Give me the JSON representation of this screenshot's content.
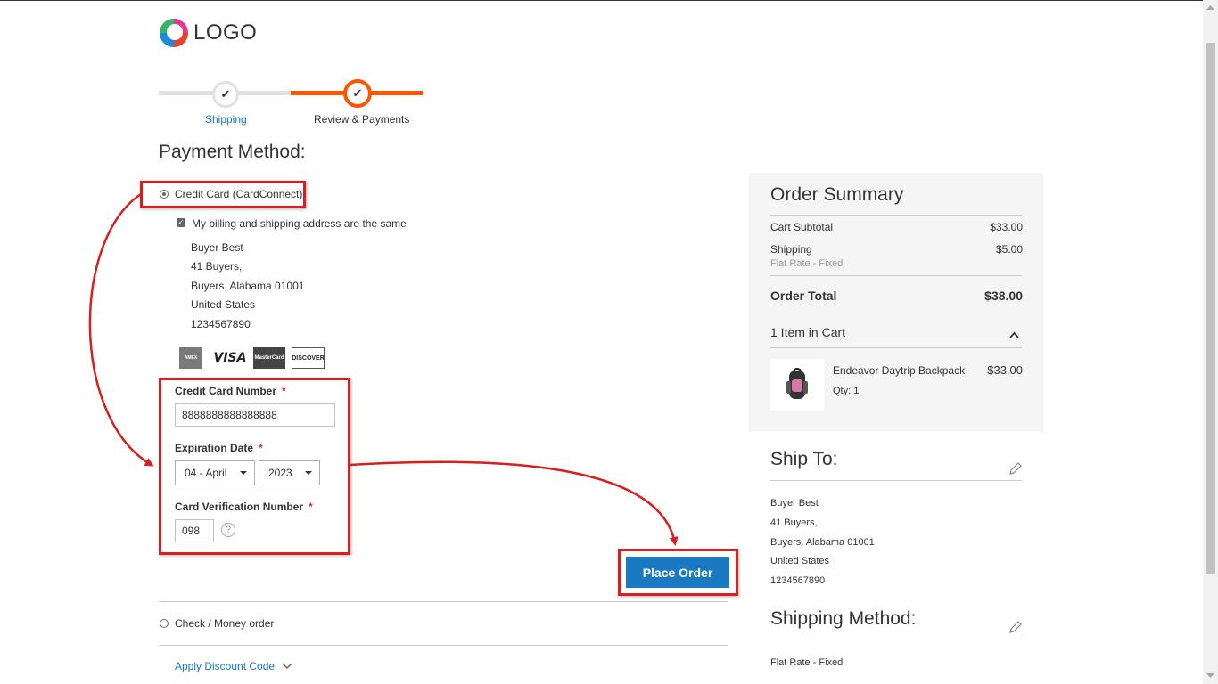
{
  "logo": {
    "text": "LOGO"
  },
  "progress": {
    "steps": [
      {
        "label": "Shipping",
        "status": "done"
      },
      {
        "label": "Review & Payments",
        "status": "active"
      }
    ]
  },
  "payment": {
    "title": "Payment Method:",
    "credit_card_option": "Credit Card (CardConnect)",
    "billing_same_label": "My billing and shipping address are the same",
    "billing_address": [
      "Buyer Best",
      "41 Buyers,",
      "Buyers, Alabama 01001",
      "United States",
      "1234567890"
    ],
    "card_types": [
      "AMEX",
      "VISA",
      "MasterCard",
      "DISCOVER"
    ],
    "card_number_label": "Credit Card Number",
    "card_number_value": "8888888888888888",
    "expiration_label": "Expiration Date",
    "expiration_month": "04 - April",
    "expiration_year": "2023",
    "cvv_label": "Card Verification Number",
    "cvv_value": "098",
    "help_glyph": "?",
    "required_mark": "*",
    "place_order_label": "Place Order",
    "check_money_option": "Check / Money order",
    "discount_label": "Apply Discount Code"
  },
  "summary": {
    "title": "Order Summary",
    "cart_subtotal_label": "Cart Subtotal",
    "cart_subtotal_value": "$33.00",
    "shipping_label": "Shipping",
    "shipping_value": "$5.00",
    "shipping_method": "Flat Rate - Fixed",
    "order_total_label": "Order Total",
    "order_total_value": "$38.00",
    "items_in_cart": "1 Item in Cart",
    "item": {
      "name": "Endeavor Daytrip Backpack",
      "qty": "Qty: 1",
      "price": "$33.00"
    }
  },
  "ship_to": {
    "title": "Ship To:",
    "address": [
      "Buyer Best",
      "41 Buyers,",
      "Buyers, Alabama 01001",
      "United States",
      "1234567890"
    ]
  },
  "shipping_method": {
    "title": "Shipping Method:",
    "value": "Flat Rate - Fixed"
  },
  "colors": {
    "accent": "#ff5501",
    "primary_button": "#1979c3",
    "annotation": "#d81e1e"
  },
  "icons": [
    "checkmark-icon",
    "chevron-down-icon",
    "chevron-up-icon",
    "pencil-icon",
    "help-icon"
  ]
}
